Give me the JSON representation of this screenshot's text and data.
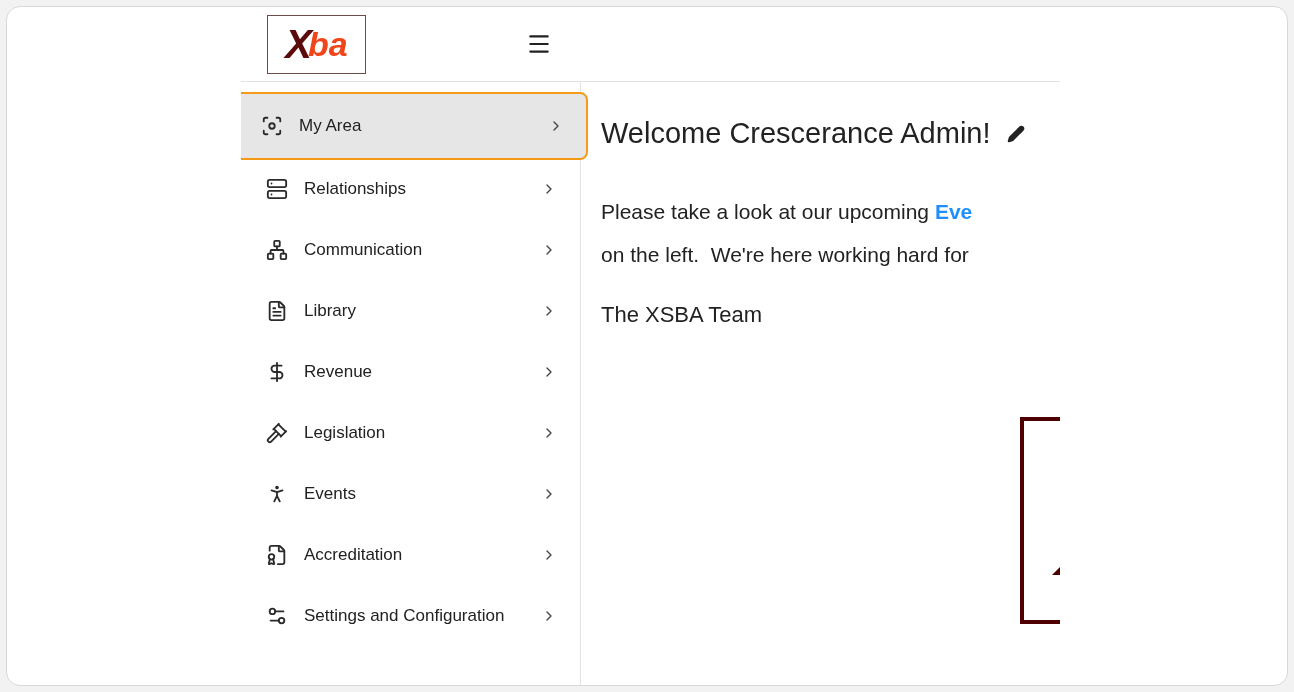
{
  "logo": {
    "mark": "X",
    "text": "ba"
  },
  "sidebar": {
    "items": [
      {
        "label": "My Area",
        "selected": true
      },
      {
        "label": "Relationships",
        "selected": false
      },
      {
        "label": "Communication",
        "selected": false
      },
      {
        "label": "Library",
        "selected": false
      },
      {
        "label": "Revenue",
        "selected": false
      },
      {
        "label": "Legislation",
        "selected": false
      },
      {
        "label": "Events",
        "selected": false
      },
      {
        "label": "Accreditation",
        "selected": false
      },
      {
        "label": "Settings and Configuration",
        "selected": false
      }
    ]
  },
  "content": {
    "title": "Welcome Crescerance Admin!",
    "paragraph": {
      "before": "Please take a look at our upcoming ",
      "link": "Eve",
      "after": "on the left.  We're here working hard for"
    },
    "signature": "The XSBA Team"
  }
}
